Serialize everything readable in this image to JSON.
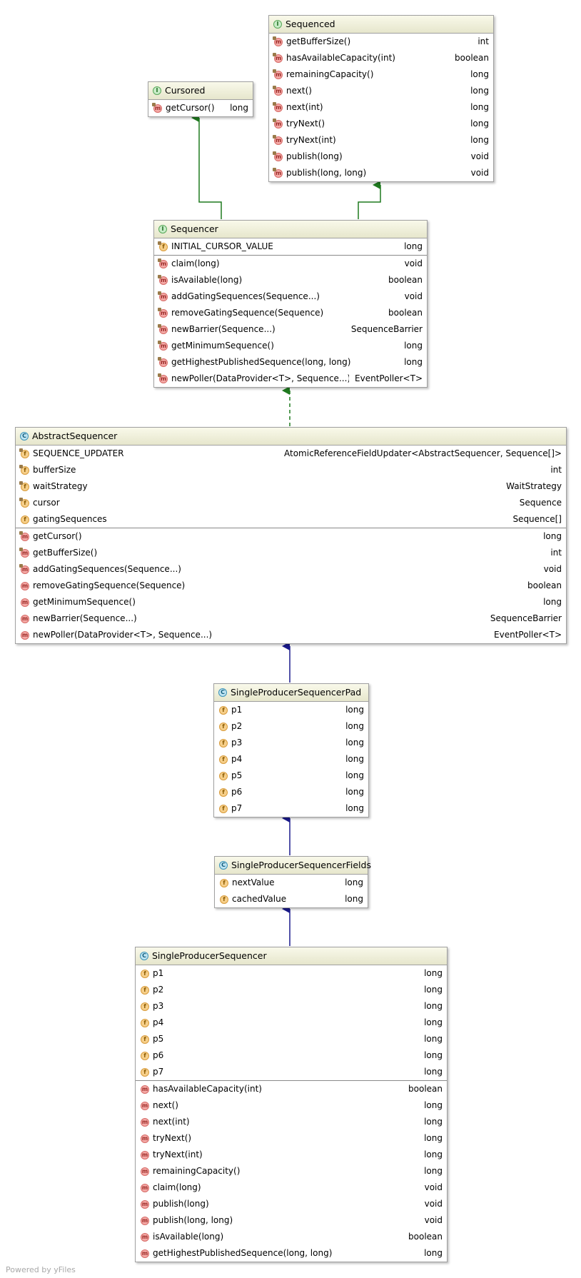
{
  "footer": "Powered by yFiles",
  "classes": {
    "sequenced": {
      "name": "Sequenced",
      "kind": "interface",
      "methods": [
        {
          "name": "getBufferSize()",
          "type": "int"
        },
        {
          "name": "hasAvailableCapacity(int)",
          "type": "boolean"
        },
        {
          "name": "remainingCapacity()",
          "type": "long"
        },
        {
          "name": "next()",
          "type": "long"
        },
        {
          "name": "next(int)",
          "type": "long"
        },
        {
          "name": "tryNext()",
          "type": "long"
        },
        {
          "name": "tryNext(int)",
          "type": "long"
        },
        {
          "name": "publish(long)",
          "type": "void"
        },
        {
          "name": "publish(long, long)",
          "type": "void"
        }
      ]
    },
    "cursored": {
      "name": "Cursored",
      "kind": "interface",
      "methods": [
        {
          "name": "getCursor()",
          "type": "long"
        }
      ]
    },
    "sequencer": {
      "name": "Sequencer",
      "kind": "interface",
      "fields": [
        {
          "name": "INITIAL_CURSOR_VALUE",
          "type": "long",
          "static": true
        }
      ],
      "methods": [
        {
          "name": "claim(long)",
          "type": "void"
        },
        {
          "name": "isAvailable(long)",
          "type": "boolean"
        },
        {
          "name": "addGatingSequences(Sequence...)",
          "type": "void"
        },
        {
          "name": "removeGatingSequence(Sequence)",
          "type": "boolean"
        },
        {
          "name": "newBarrier(Sequence...)",
          "type": "SequenceBarrier"
        },
        {
          "name": "getMinimumSequence()",
          "type": "long"
        },
        {
          "name": "getHighestPublishedSequence(long, long)",
          "type": "long"
        },
        {
          "name": "newPoller(DataProvider<T>, Sequence...)",
          "type": "EventPoller<T>"
        }
      ]
    },
    "abstract_sequencer": {
      "name": "AbstractSequencer",
      "kind": "abstract class",
      "fields": [
        {
          "name": "SEQUENCE_UPDATER",
          "type": "AtomicReferenceFieldUpdater<AbstractSequencer, Sequence[]>",
          "static": true
        },
        {
          "name": "bufferSize",
          "type": "int",
          "static": false
        },
        {
          "name": "waitStrategy",
          "type": "WaitStrategy",
          "static": false
        },
        {
          "name": "cursor",
          "type": "Sequence",
          "static": false
        },
        {
          "name": "gatingSequences",
          "type": "Sequence[]",
          "static": false
        }
      ],
      "methods": [
        {
          "name": "getCursor()",
          "type": "long"
        },
        {
          "name": "getBufferSize()",
          "type": "int"
        },
        {
          "name": "addGatingSequences(Sequence...)",
          "type": "void"
        },
        {
          "name": "removeGatingSequence(Sequence)",
          "type": "boolean"
        },
        {
          "name": "getMinimumSequence()",
          "type": "long"
        },
        {
          "name": "newBarrier(Sequence...)",
          "type": "SequenceBarrier"
        },
        {
          "name": "newPoller(DataProvider<T>, Sequence...)",
          "type": "EventPoller<T>"
        }
      ]
    },
    "pad": {
      "name": "SingleProducerSequencerPad",
      "kind": "abstract class",
      "fields": [
        {
          "name": "p1",
          "type": "long"
        },
        {
          "name": "p2",
          "type": "long"
        },
        {
          "name": "p3",
          "type": "long"
        },
        {
          "name": "p4",
          "type": "long"
        },
        {
          "name": "p5",
          "type": "long"
        },
        {
          "name": "p6",
          "type": "long"
        },
        {
          "name": "p7",
          "type": "long"
        }
      ]
    },
    "fields_cls": {
      "name": "SingleProducerSequencerFields",
      "kind": "abstract class",
      "fields": [
        {
          "name": "nextValue",
          "type": "long"
        },
        {
          "name": "cachedValue",
          "type": "long"
        }
      ]
    },
    "single": {
      "name": "SingleProducerSequencer",
      "kind": "final class",
      "fields": [
        {
          "name": "p1",
          "type": "long"
        },
        {
          "name": "p2",
          "type": "long"
        },
        {
          "name": "p3",
          "type": "long"
        },
        {
          "name": "p4",
          "type": "long"
        },
        {
          "name": "p5",
          "type": "long"
        },
        {
          "name": "p6",
          "type": "long"
        },
        {
          "name": "p7",
          "type": "long"
        }
      ],
      "methods": [
        {
          "name": "hasAvailableCapacity(int)",
          "type": "boolean"
        },
        {
          "name": "next()",
          "type": "long"
        },
        {
          "name": "next(int)",
          "type": "long"
        },
        {
          "name": "tryNext()",
          "type": "long"
        },
        {
          "name": "tryNext(int)",
          "type": "long"
        },
        {
          "name": "remainingCapacity()",
          "type": "long"
        },
        {
          "name": "claim(long)",
          "type": "void"
        },
        {
          "name": "publish(long)",
          "type": "void"
        },
        {
          "name": "publish(long, long)",
          "type": "void"
        },
        {
          "name": "isAvailable(long)",
          "type": "boolean"
        },
        {
          "name": "getHighestPublishedSequence(long, long)",
          "type": "long"
        }
      ]
    }
  },
  "colors": {
    "implements_arrow": "#1f7a1f",
    "extends_arrow": "#1a1a8c"
  }
}
